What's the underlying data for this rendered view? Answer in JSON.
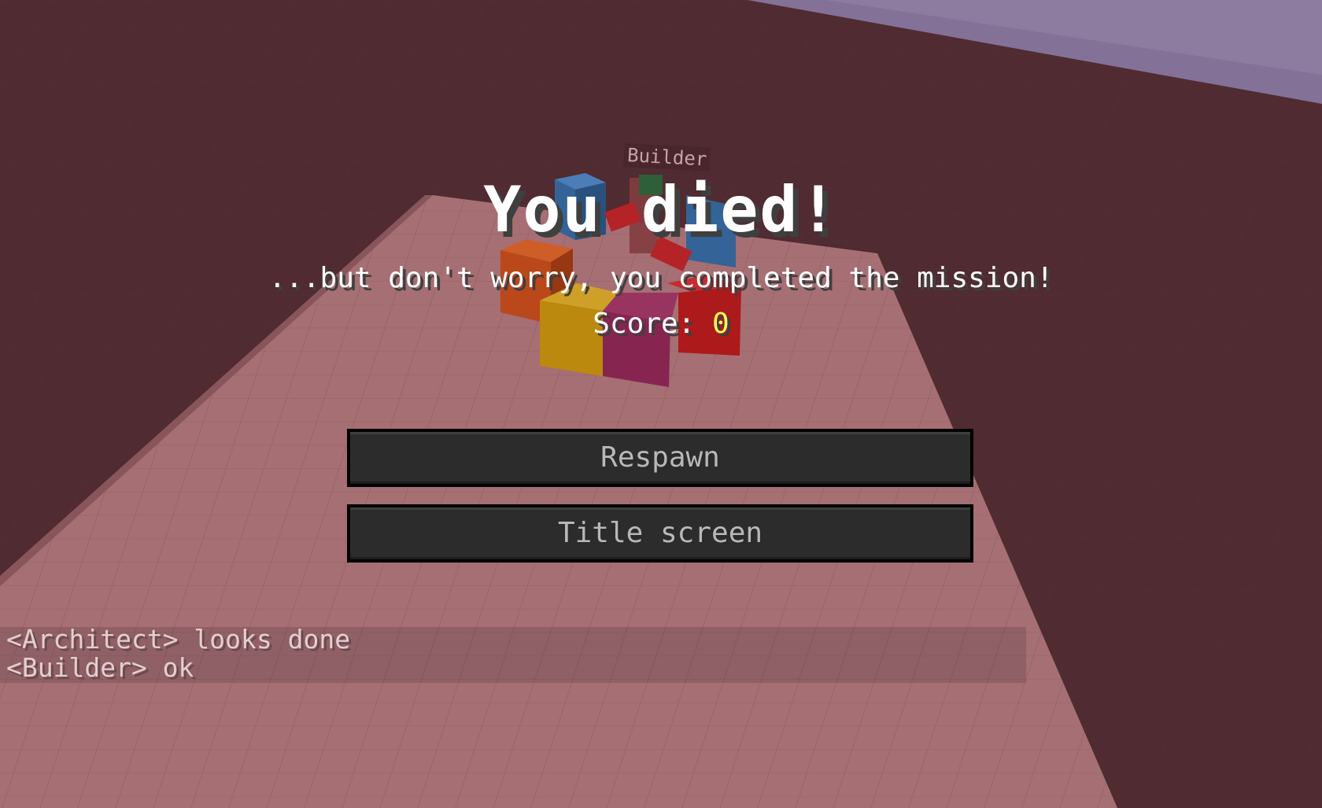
{
  "death_screen": {
    "title": "You died!",
    "subtitle": "...but don't worry, you completed the mission!",
    "score_label": "Score: ",
    "score_value": "0"
  },
  "buttons": {
    "respawn_label": "Respawn",
    "title_screen_label": "Title screen"
  },
  "chat": {
    "messages": [
      {
        "text": "<Architect> looks done"
      },
      {
        "text": "<Builder> ok"
      }
    ]
  },
  "world": {
    "player_nametag": "Builder",
    "colors": {
      "ground": "#4f2f34",
      "sky": "#8a7fa8",
      "platform": "#b07d80",
      "block_blue": "#2f70a8",
      "block_orange": "#c8501a",
      "block_yellow": "#c99a0c",
      "block_magenta": "#8e2858",
      "block_red": "#b81c1c"
    }
  }
}
